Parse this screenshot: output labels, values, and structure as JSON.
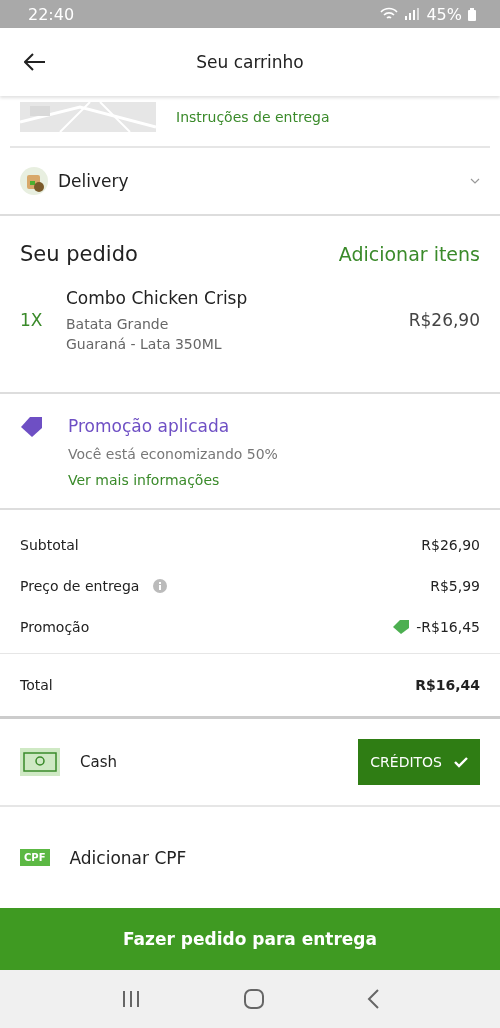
{
  "status_bar": {
    "time": "22:40",
    "battery": "45%"
  },
  "header": {
    "title": "Seu carrinho"
  },
  "address": {
    "link": "Instruções de entrega"
  },
  "delivery": {
    "label": "Delivery"
  },
  "order": {
    "title": "Seu pedido",
    "add_link": "Adicionar itens",
    "items": [
      {
        "quantity": "1X",
        "name": "Combo Chicken Crisp",
        "options": [
          "Batata Grande",
          "Guaraná - Lata 350ML"
        ],
        "price": "R$26,90"
      }
    ]
  },
  "promotion": {
    "title": "Promoção aplicada",
    "text": "Você está economizando 50%",
    "link": "Ver mais informações"
  },
  "summary": [
    {
      "kind": "plain",
      "label": "Subtotal",
      "value": "R$26,90"
    },
    {
      "kind": "info",
      "label": "Preço de entrega",
      "value": "R$5,99"
    },
    {
      "kind": "promo",
      "label": "Promoção",
      "value": "-R$16,45"
    }
  ],
  "total": {
    "label": "Total",
    "value": "R$16,44"
  },
  "payment": {
    "method": "Cash",
    "credits_button": "CRÉDITOS",
    "credits_checked": true
  },
  "cpf": {
    "badge": "CPF",
    "label": "Adicionar CPF"
  },
  "submit_button": "Fazer pedido para entrega"
}
